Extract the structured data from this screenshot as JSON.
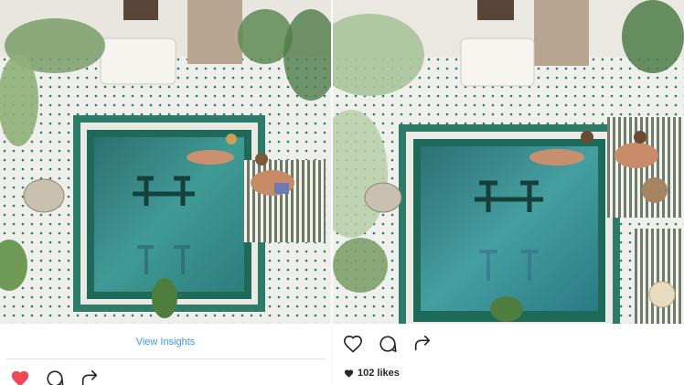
{
  "left_post": {
    "insights_label": "View Insights",
    "liked": true,
    "icons": [
      "heart-filled-icon",
      "comment-icon",
      "share-icon"
    ]
  },
  "right_post": {
    "likes_label": "102 likes",
    "icons": [
      "heart-outline-icon",
      "comment-icon",
      "share-icon"
    ]
  },
  "colors": {
    "like_red": "#ed4956",
    "link_blue": "#3897f0",
    "icon_dark": "#262626",
    "pool_teal": "#2f8a86",
    "tile_green": "#1f6e5c"
  }
}
